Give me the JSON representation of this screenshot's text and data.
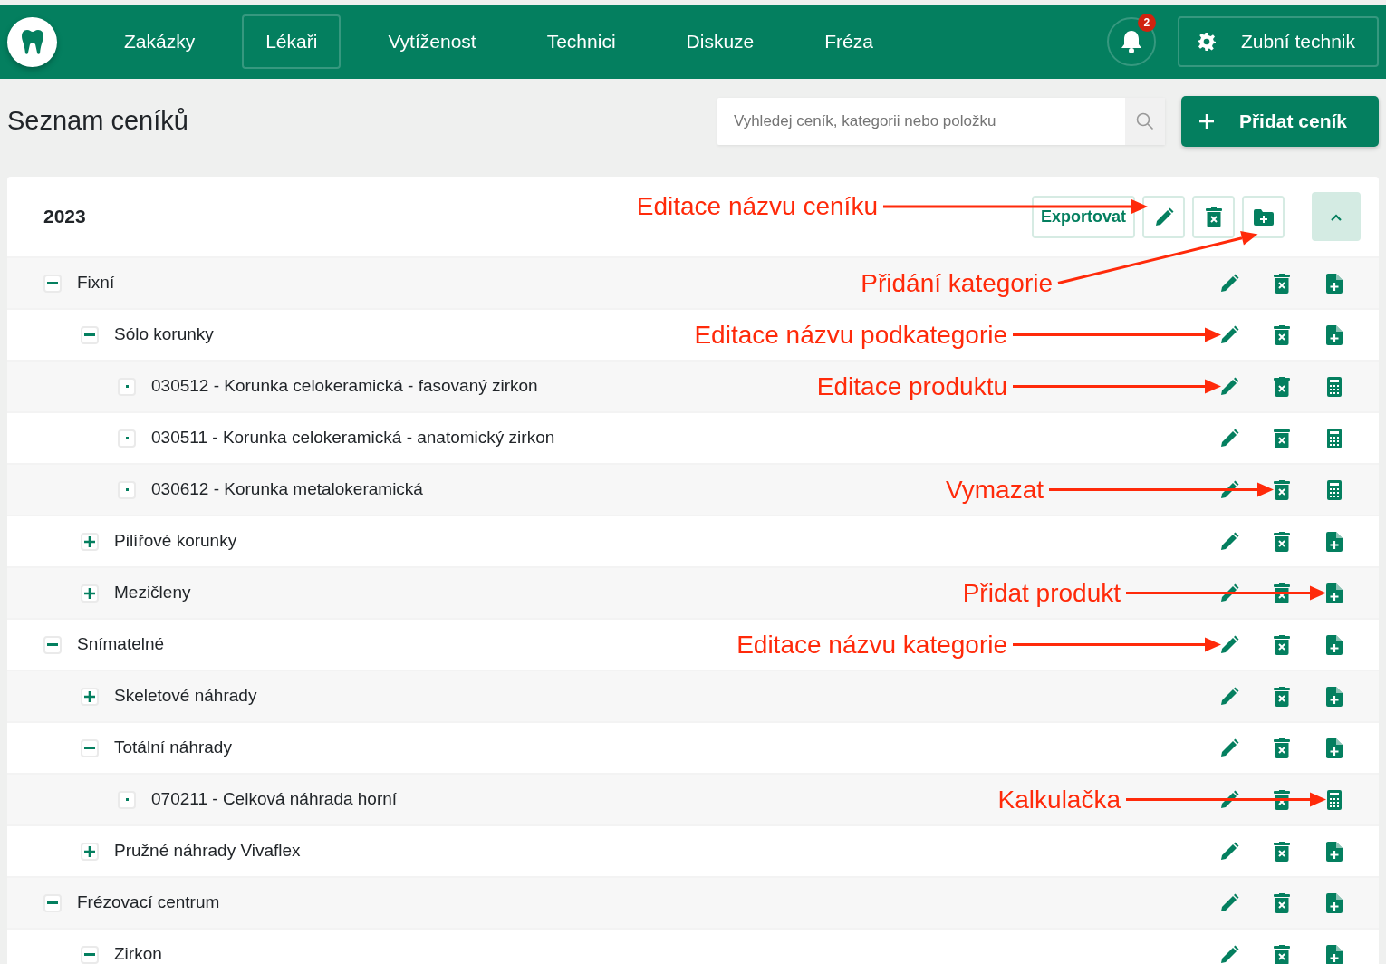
{
  "navbar": {
    "items": [
      {
        "label": "Zakázky",
        "selected": false
      },
      {
        "label": "Lékaři",
        "selected": true
      },
      {
        "label": "Vytíženost",
        "selected": false
      },
      {
        "label": "Technici",
        "selected": false
      },
      {
        "label": "Diskuze",
        "selected": false
      },
      {
        "label": "Fréza",
        "selected": false
      }
    ],
    "notifications": {
      "count": "2"
    },
    "user": {
      "label": "Zubní technik"
    }
  },
  "page_title": "Seznam ceníků",
  "search": {
    "placeholder": "Vyhledej ceník, kategorii nebo položku"
  },
  "add_button": {
    "label": "Přidat ceník"
  },
  "pricelist": {
    "title": "2023",
    "export_label": "Exportovat",
    "expanded": true,
    "annotation": {
      "text": "Editace názvu ceníku",
      "kind": "header_edit"
    },
    "rows": [
      {
        "name": "Fixní",
        "kind": "category",
        "expanded": true,
        "annotation": {
          "text": "Přidání kategorie",
          "kind": "header_add"
        },
        "children": [
          {
            "name": "Sólo korunky",
            "kind": "category",
            "expanded": true,
            "annotation": {
              "text": "Editace názvu podkategorie",
              "kind": "edit"
            },
            "children": [
              {
                "name": "030512 - Korunka celokeramická - fasovaný zirkon",
                "kind": "product",
                "annotation": {
                  "text": "Editace produktu",
                  "kind": "edit"
                }
              },
              {
                "name": "030511 - Korunka celokeramická - anatomický zirkon",
                "kind": "product"
              },
              {
                "name": "030612 - Korunka metalokeramická",
                "kind": "product",
                "annotation": {
                  "text": "Vymazat",
                  "kind": "delete"
                }
              }
            ]
          },
          {
            "name": "Pilířové korunky",
            "kind": "category",
            "expanded": false
          },
          {
            "name": "Mezičleny",
            "kind": "category",
            "expanded": false,
            "annotation": {
              "text": "Přidat produkt",
              "kind": "add"
            }
          }
        ]
      },
      {
        "name": "Snímatelné",
        "kind": "category",
        "expanded": true,
        "annotation": {
          "text": "Editace názvu kategorie",
          "kind": "edit"
        },
        "children": [
          {
            "name": "Skeletové náhrady",
            "kind": "category",
            "expanded": false
          },
          {
            "name": "Totální náhrady",
            "kind": "category",
            "expanded": true,
            "children": [
              {
                "name": "070211 - Celková náhrada horní",
                "kind": "product",
                "annotation": {
                  "text": "Kalkulačka",
                  "kind": "add"
                }
              }
            ]
          },
          {
            "name": "Pružné náhrady Vivaflex",
            "kind": "category",
            "expanded": false
          }
        ]
      },
      {
        "name": "Frézovací centrum",
        "kind": "category",
        "expanded": true,
        "children": [
          {
            "name": "Zirkon",
            "kind": "category",
            "expanded": true
          }
        ]
      }
    ]
  }
}
